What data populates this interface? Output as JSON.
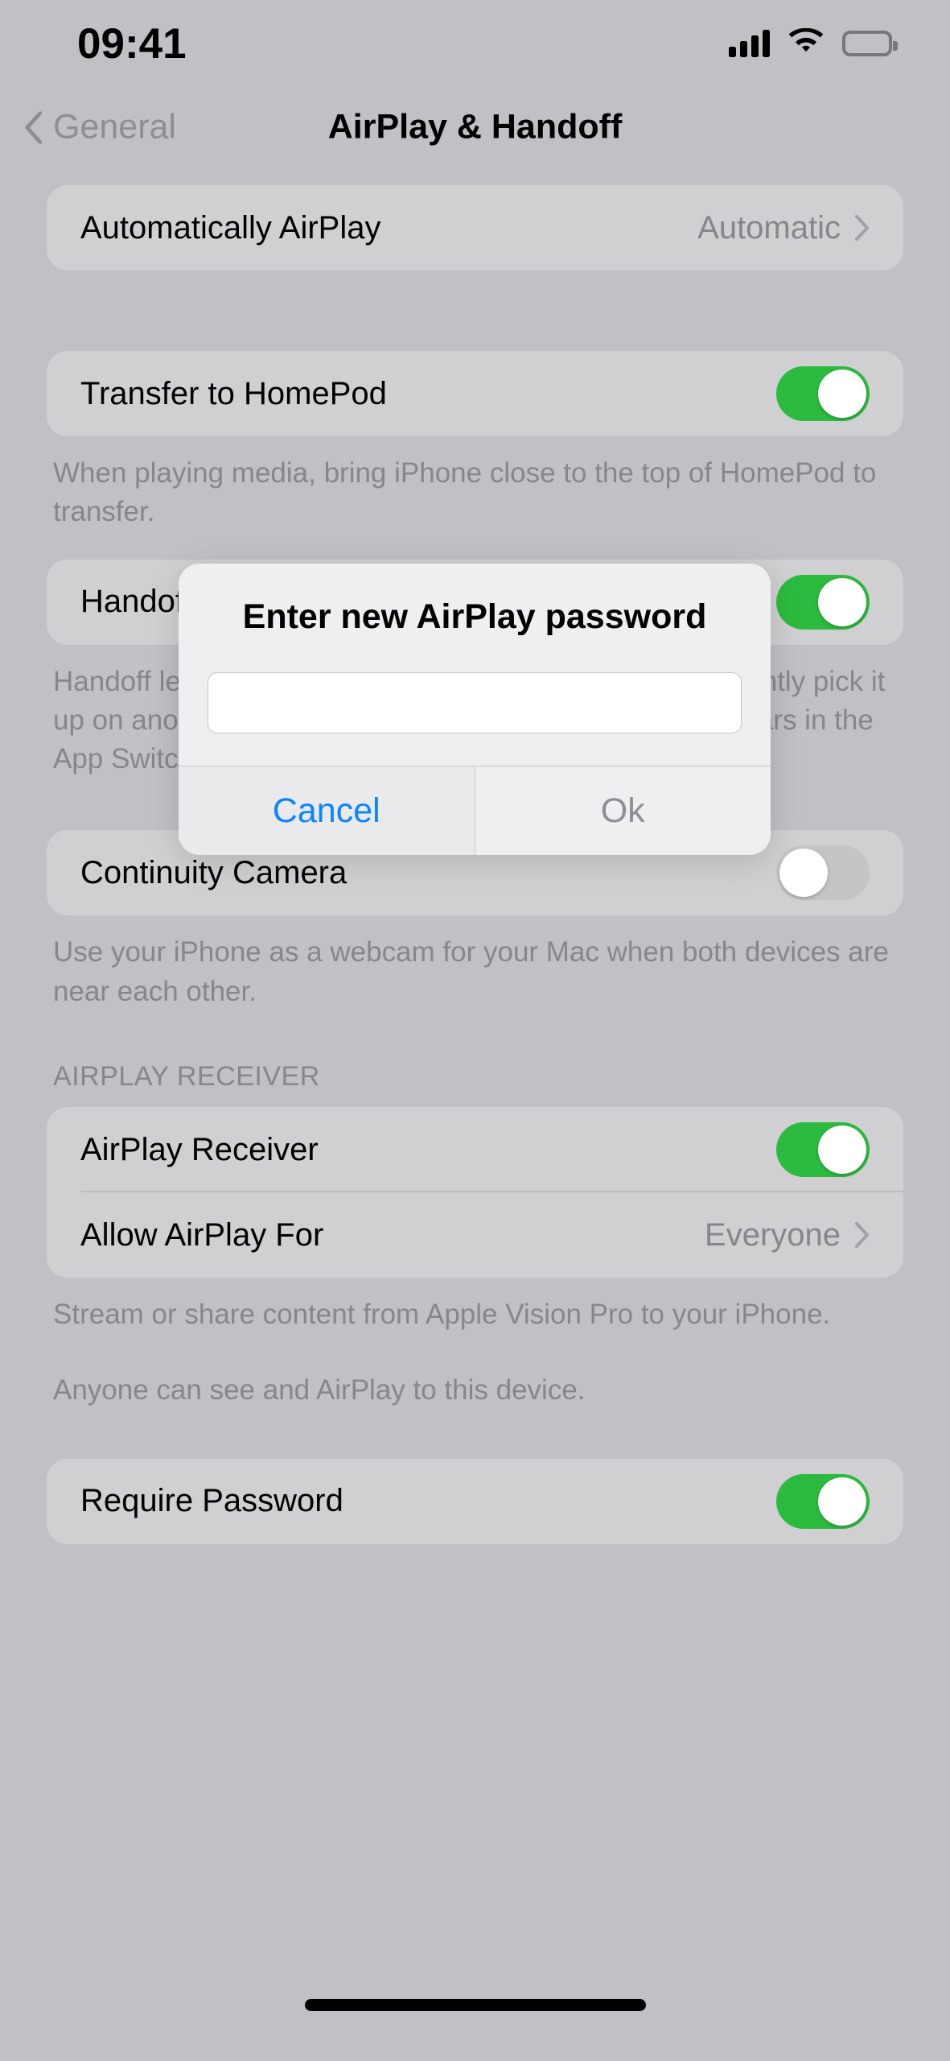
{
  "status_bar": {
    "time": "09:41",
    "signal_icon": "cellular-signal-icon",
    "wifi_icon": "wifi-icon",
    "battery_icon": "battery-full-icon"
  },
  "nav": {
    "back_label": "General",
    "back_icon": "chevron-left-icon",
    "title": "AirPlay & Handoff"
  },
  "sections": {
    "auto_airplay": {
      "label": "Automatically AirPlay",
      "value": "Automatic",
      "chevron_icon": "chevron-right-icon"
    },
    "homepod": {
      "label": "Transfer to HomePod",
      "toggle": "on",
      "footer": "When playing media, bring iPhone close to the top of HomePod to transfer."
    },
    "handoff": {
      "label": "Handoff",
      "toggle": "on",
      "footer": "Handoff lets you start something on one device and instantly pick it up on another nearby device. The app you're using appears in the App Switcher, and in the Dock on a Mac."
    },
    "continuity_camera": {
      "label": "Continuity Camera",
      "toggle": "off",
      "footer": "Use your iPhone as a webcam for your Mac when both devices are near each other."
    },
    "airplay_receiver": {
      "header": "AIRPLAY RECEIVER",
      "receiver_label": "AirPlay Receiver",
      "receiver_toggle": "on",
      "allow_label": "Allow AirPlay For",
      "allow_value": "Everyone",
      "allow_chevron_icon": "chevron-right-icon",
      "footer_1": "Stream or share content from Apple Vision Pro to your iPhone.",
      "footer_2": "Anyone can see and AirPlay to this device."
    },
    "require_password": {
      "label": "Require Password",
      "toggle": "on"
    }
  },
  "alert": {
    "title": "Enter new AirPlay password",
    "input_value": "",
    "input_placeholder": "",
    "cancel_label": "Cancel",
    "ok_label": "Ok"
  },
  "colors": {
    "toggle_on": "#2cbb3f",
    "toggle_off": "#c5c5c8",
    "accent_blue": "#0a84ff",
    "disabled_gray": "#8e8e93",
    "page_background": "#c0c0c5",
    "card_background": "#d0d0d2",
    "alert_background": "#efeff1"
  },
  "home_indicator": "home-indicator"
}
